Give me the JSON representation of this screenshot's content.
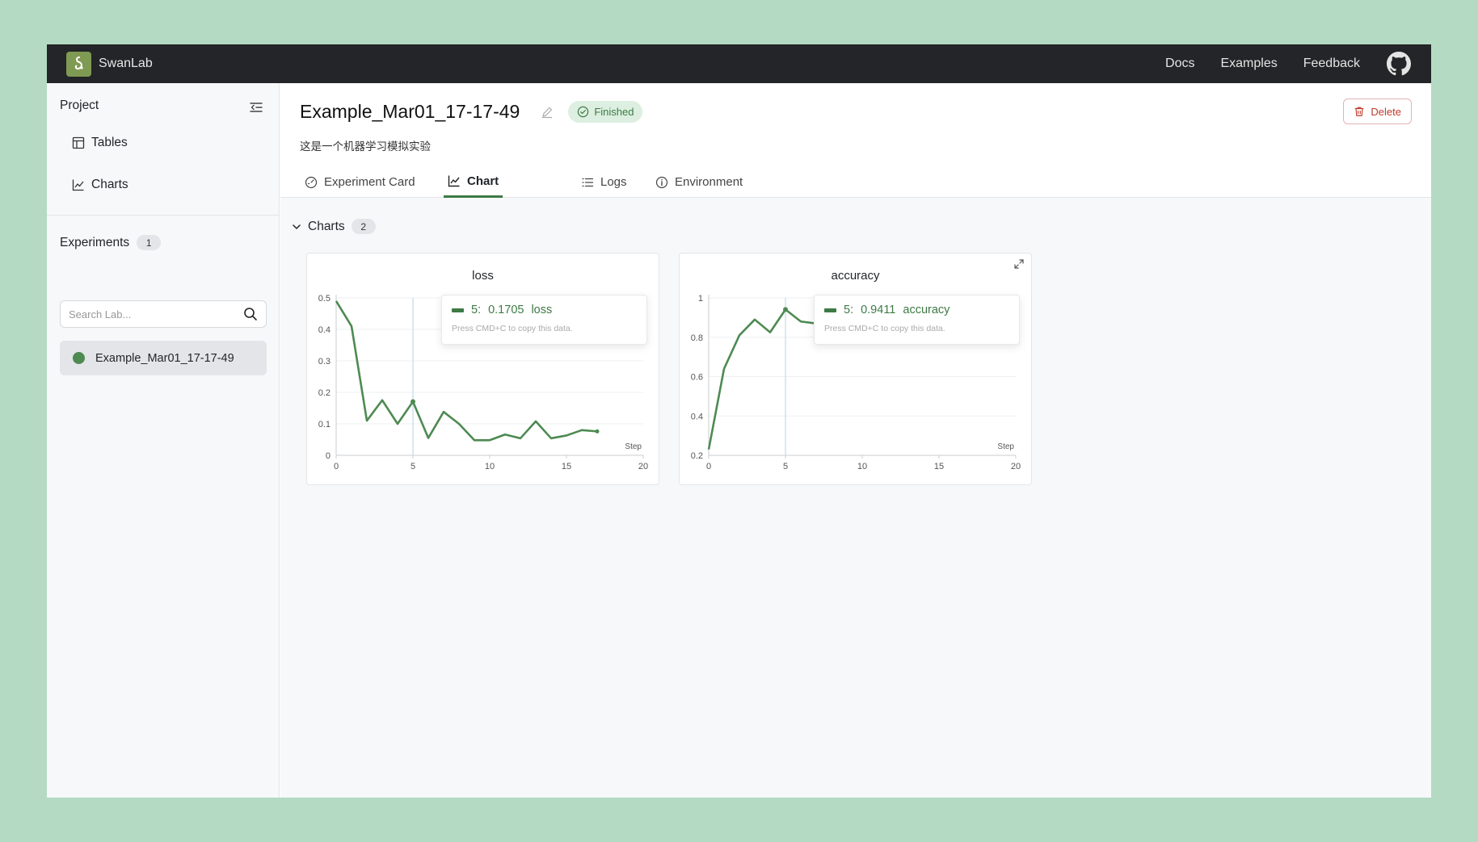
{
  "app": {
    "name": "SwanLab"
  },
  "topnav": [
    "Docs",
    "Examples",
    "Feedback"
  ],
  "sidebar": {
    "project_label": "Project",
    "items": [
      {
        "label": "Tables",
        "icon": "table-icon"
      },
      {
        "label": "Charts",
        "icon": "line-chart-icon"
      }
    ],
    "experiments_label": "Experiments",
    "experiments_count": "1",
    "search_placeholder": "Search Lab...",
    "experiment_item": "Example_Mar01_17-17-49"
  },
  "main": {
    "title": "Example_Mar01_17-17-49",
    "status": "Finished",
    "description": "这是一个机器学习模拟实验",
    "delete_label": "Delete",
    "tabs": [
      {
        "label": "Experiment Card",
        "icon": "gauge-icon"
      },
      {
        "label": "Chart",
        "icon": "line-chart-icon",
        "active": true
      },
      {
        "label": "Logs",
        "icon": "list-icon"
      },
      {
        "label": "Environment",
        "icon": "info-icon"
      }
    ],
    "charts_group_label": "Charts",
    "charts_count": "2"
  },
  "colors": {
    "accent": "#3d7a45",
    "line": "#4e8a52",
    "topbar": "#232528"
  },
  "chart_data": [
    {
      "type": "line",
      "title": "loss",
      "xlabel": "Step",
      "ylabel": "",
      "xlim": [
        0,
        20
      ],
      "ylim": [
        0,
        0.5
      ],
      "xticks": [
        "0",
        "5",
        "10",
        "15",
        "20"
      ],
      "yticks": [
        "0",
        "0.1",
        "0.2",
        "0.3",
        "0.4",
        "0.5"
      ],
      "series": [
        {
          "x": [
            0,
            1,
            2,
            3,
            4,
            5,
            6,
            7,
            8,
            9,
            10,
            11,
            12,
            13,
            14,
            15,
            16,
            17
          ],
          "y": [
            0.49,
            0.41,
            0.11,
            0.175,
            0.1,
            0.1705,
            0.055,
            0.138,
            0.1,
            0.048,
            0.048,
            0.066,
            0.054,
            0.108,
            0.054,
            0.063,
            0.08,
            0.076
          ]
        }
      ],
      "tooltip": {
        "step": "5:",
        "value": "0.1705",
        "name": "loss",
        "hint": "Press CMD+C to copy this data."
      }
    },
    {
      "type": "line",
      "title": "accuracy",
      "xlabel": "Step",
      "ylabel": "",
      "xlim": [
        0,
        20
      ],
      "ylim": [
        0.2,
        1
      ],
      "xticks": [
        "0",
        "5",
        "10",
        "15",
        "20"
      ],
      "yticks": [
        "0.2",
        "0.4",
        "0.6",
        "0.8",
        "1"
      ],
      "series": [
        {
          "x": [
            0,
            1,
            2,
            3,
            4,
            5,
            6,
            7
          ],
          "y": [
            0.23,
            0.64,
            0.81,
            0.89,
            0.825,
            0.9411,
            0.88,
            0.87
          ]
        }
      ],
      "tooltip": {
        "step": "5:",
        "value": "0.9411",
        "name": "accuracy",
        "hint": "Press CMD+C to copy this data."
      }
    }
  ]
}
